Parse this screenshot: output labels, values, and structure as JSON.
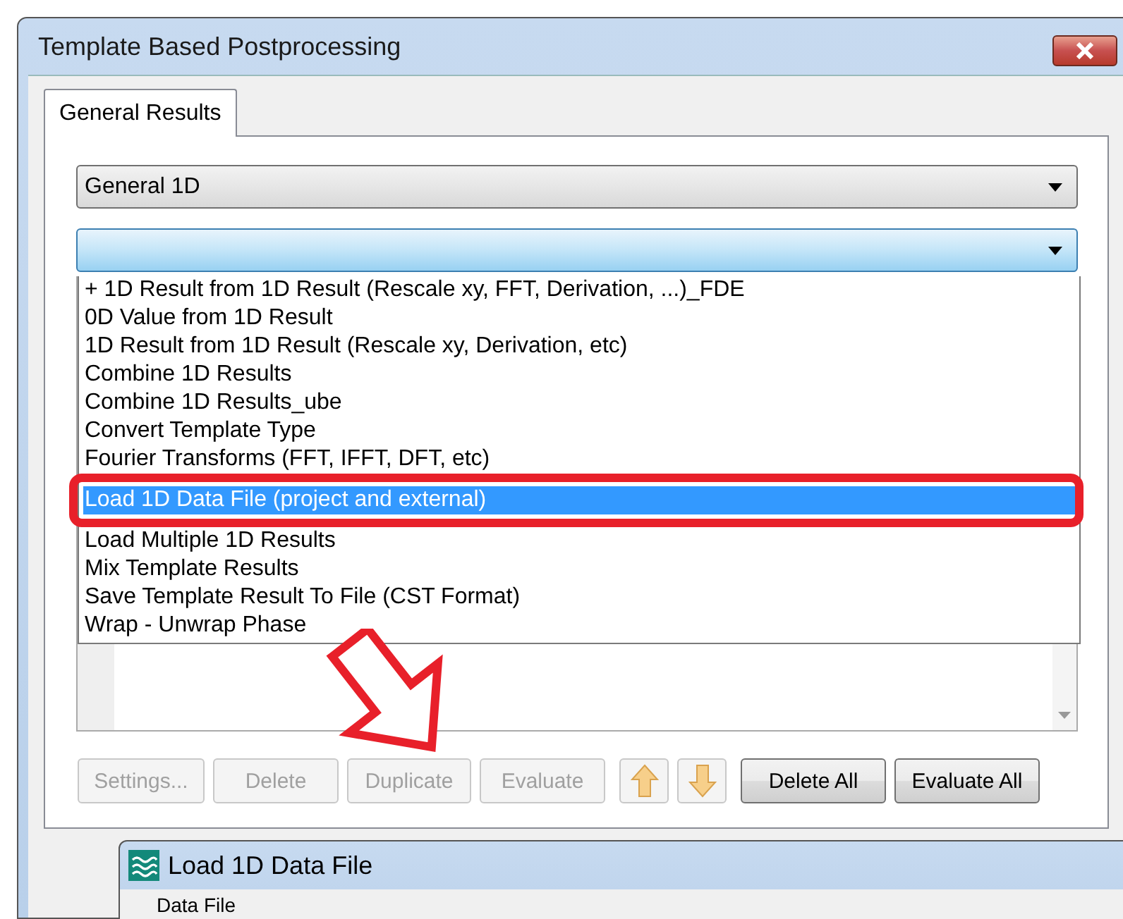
{
  "window": {
    "title": "Template Based Postprocessing"
  },
  "tabs": [
    {
      "label": "General Results",
      "selected": true
    }
  ],
  "category_dropdown": {
    "value": "General 1D"
  },
  "template_dropdown": {
    "open": true
  },
  "template_list": [
    {
      "label": "+ 1D Result from 1D Result (Rescale xy, FFT, Derivation, ...)_FDE",
      "selected": false
    },
    {
      "label": "0D Value from 1D Result",
      "selected": false
    },
    {
      "label": "1D Result from 1D Result (Rescale xy, Derivation, etc)",
      "selected": false
    },
    {
      "label": "Combine 1D Results",
      "selected": false
    },
    {
      "label": "Combine 1D Results_ube",
      "selected": false
    },
    {
      "label": "Convert Template Type",
      "selected": false
    },
    {
      "label": "Fourier Transforms (FFT, IFFT, DFT, etc)",
      "selected": false
    },
    {
      "label": "Load 1D Data File (project and external)",
      "selected": true
    },
    {
      "label": "Load Multiple 1D Results",
      "selected": false
    },
    {
      "label": "Mix Template Results",
      "selected": false
    },
    {
      "label": "Save Template Result To File (CST Format)",
      "selected": false
    },
    {
      "label": "Wrap - Unwrap Phase",
      "selected": false
    }
  ],
  "buttons": [
    {
      "kind": "text",
      "label": "Settings...",
      "disabled": true
    },
    {
      "kind": "text",
      "label": "Delete",
      "disabled": true
    },
    {
      "kind": "text",
      "label": "Duplicate",
      "disabled": true
    },
    {
      "kind": "text",
      "label": "Evaluate",
      "disabled": true
    },
    {
      "kind": "arrow-up",
      "disabled": true
    },
    {
      "kind": "arrow-down",
      "disabled": true
    },
    {
      "kind": "text",
      "label": "Delete All",
      "disabled": false
    },
    {
      "kind": "text",
      "label": "Evaluate All",
      "disabled": false
    }
  ],
  "child_window": {
    "title": "Load 1D Data File",
    "field_label": "Data File"
  }
}
